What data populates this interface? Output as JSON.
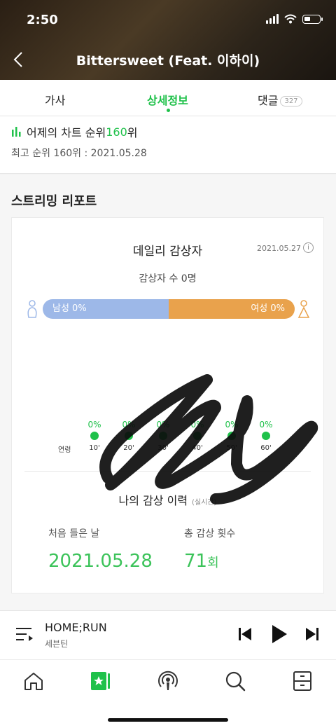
{
  "status_bar": {
    "time": "2:50"
  },
  "header": {
    "title": "Bittersweet (Feat. 이하이)"
  },
  "tabs": [
    {
      "label": "가사"
    },
    {
      "label": "상세정보",
      "active": true
    },
    {
      "label": "댓글",
      "badge": "327"
    }
  ],
  "chart_info": {
    "rank_prefix": "어제의 차트 순위 ",
    "rank_value": "160",
    "rank_suffix": "위",
    "best_rank": "최고 순위 160위 : 2021.05.28"
  },
  "streaming": {
    "section_title": "스트리밍 리포트",
    "card_title": "데일리 감상자",
    "date": "2021.05.27",
    "listener_count": "감상자 수 0명",
    "male_label": "남성 0%",
    "female_label": "여성 0%",
    "male_share": 0.5,
    "age_axis_label": "연령",
    "age_groups": [
      {
        "label": "10'",
        "pct": "0%"
      },
      {
        "label": "20'",
        "pct": "0%"
      },
      {
        "label": "30'",
        "pct": "0%"
      },
      {
        "label": "40'",
        "pct": "0%"
      },
      {
        "label": "50'",
        "pct": "0%"
      },
      {
        "label": "60'",
        "pct": "0%"
      }
    ],
    "my_history_title": "나의 감상 이력",
    "my_history_note": "(실시간)",
    "first_listen_label": "처음 들은 날",
    "first_listen_value": "2021.05.28",
    "total_plays_label": "총 감상 횟수",
    "total_plays_value": "71",
    "total_plays_unit": "회"
  },
  "player": {
    "title": "HOME;RUN",
    "artist": "세븐틴"
  },
  "colors": {
    "accent": "#1fc14a",
    "male": "#9db8e8",
    "female": "#e9a24c"
  },
  "icons": {
    "back": "chevron-left-icon",
    "bar_chart": "bar-chart-icon",
    "info": "info-icon",
    "playlist": "playlist-icon",
    "prev": "skip-previous-icon",
    "play": "play-icon",
    "next": "skip-next-icon",
    "nav": [
      "home-icon",
      "library-icon",
      "podcast-icon",
      "search-icon",
      "storage-icon"
    ]
  }
}
